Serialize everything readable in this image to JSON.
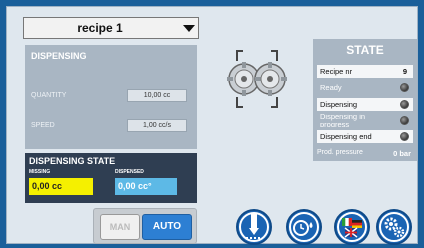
{
  "recipe": {
    "selected": "recipe 1"
  },
  "dispensing": {
    "title": "DISPENSING",
    "quantity_label": "QUANTITY",
    "quantity_value": "10,00 cc",
    "speed_label": "SPEED",
    "speed_value": "1,00 cc/s"
  },
  "dispensing_state": {
    "title": "DISPENSING STATE",
    "missing_label": "MISSING",
    "missing_value": "0,00 cc",
    "dispensed_label": "DISPENSED",
    "dispensed_value": "0,00 cc°"
  },
  "mode": {
    "off_label": "MAN",
    "on_label": "AUTO",
    "active": "AUTO"
  },
  "state": {
    "title": "STATE",
    "recipe_nr_label": "Recipe nr",
    "recipe_nr_value": "9",
    "ready_label": "Ready",
    "dispensing_label": "Dispensing",
    "in_progress_label": "Dispensing in progress",
    "dispensing_end_label": "Dispensing end",
    "pressure_label": "Prod. pressure",
    "pressure_value": "0 bar"
  },
  "icons": [
    "dispense-nozzle-icon",
    "timer-drop-icon",
    "language-flags-icon",
    "settings-gears-icon"
  ],
  "colors": {
    "background": "#1a5f9a",
    "panel": "#a9b6c3",
    "missing": "#f5f000",
    "dispensed": "#5db9e6",
    "auto": "#2d7fd3",
    "button": "#1a64b4"
  }
}
